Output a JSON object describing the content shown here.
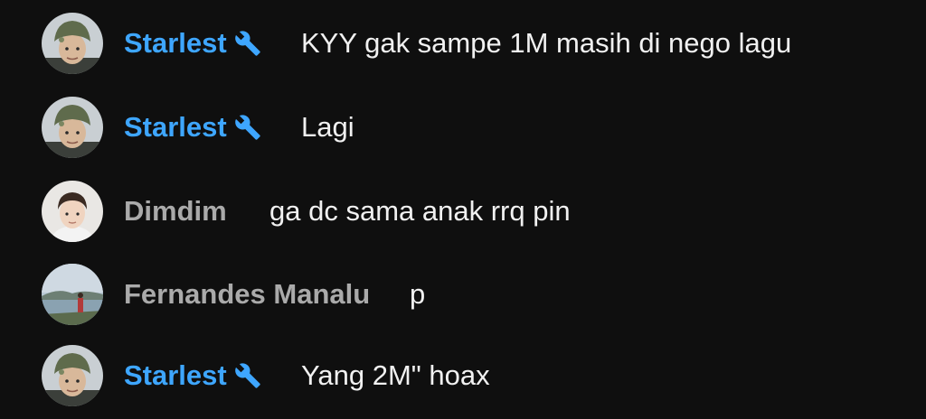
{
  "messages": [
    {
      "author": "Starlest",
      "role": "moderator",
      "badge_icon": "wrench-icon",
      "text": "KYY gak sampe 1M masih di nego lagu",
      "avatar": "avatar-soldier-helmet"
    },
    {
      "author": "Starlest",
      "role": "moderator",
      "badge_icon": "wrench-icon",
      "text": "Lagi",
      "avatar": "avatar-soldier-helmet"
    },
    {
      "author": "Dimdim",
      "role": "viewer",
      "text": "ga dc sama anak rrq pin",
      "avatar": "avatar-young-man"
    },
    {
      "author": "Fernandes Manalu",
      "role": "viewer",
      "text": "p",
      "avatar": "avatar-lake-landscape"
    },
    {
      "author": "Starlest",
      "role": "moderator",
      "badge_icon": "wrench-icon",
      "text": "Yang 2M\" hoax",
      "avatar": "avatar-soldier-helmet"
    }
  ],
  "colors": {
    "background": "#0f0f0f",
    "moderator_name": "#3ea6ff",
    "viewer_name": "#aaaaaa",
    "message_text": "#f1f1f1"
  }
}
